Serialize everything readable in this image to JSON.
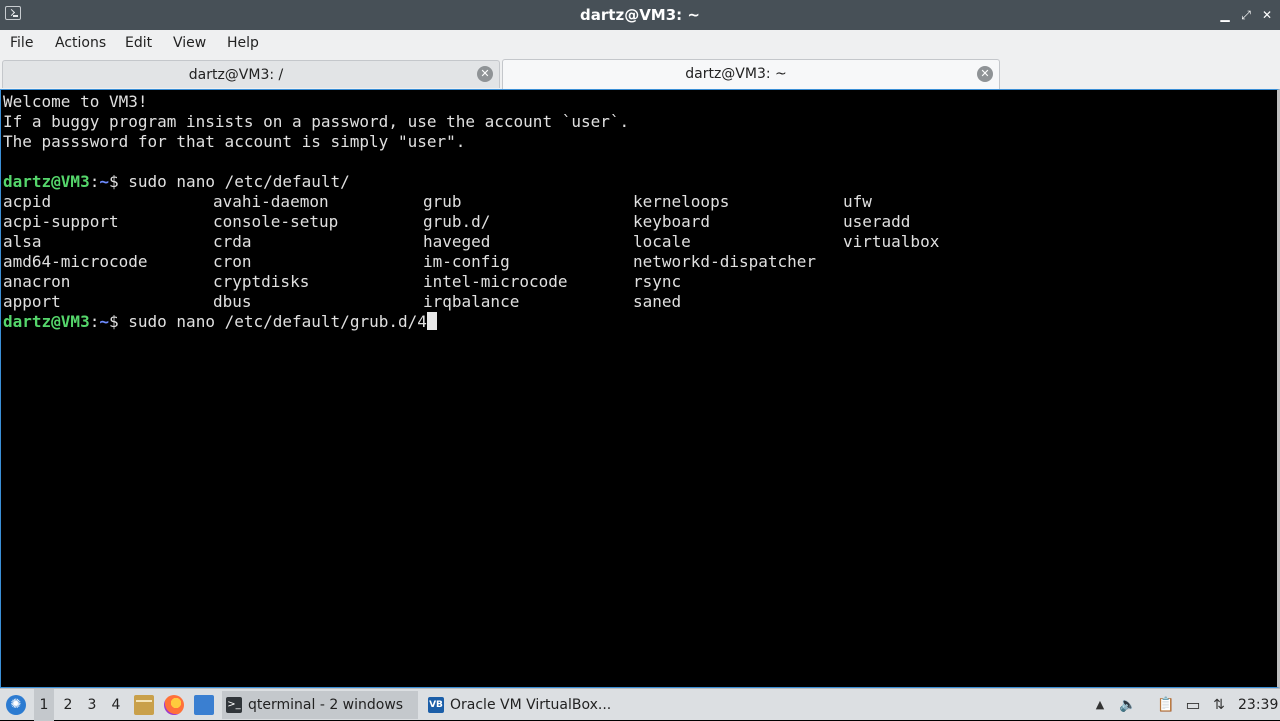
{
  "window": {
    "title": "dartz@VM3: ~",
    "controls": {
      "minimize": "▁",
      "maximize": "⤢",
      "close": "✕"
    }
  },
  "menu": [
    "File",
    "Actions",
    "Edit",
    "View",
    "Help"
  ],
  "tabs": [
    {
      "label": "dartz@VM3: /",
      "active": false
    },
    {
      "label": "dartz@VM3: ~",
      "active": true
    }
  ],
  "terminal": {
    "welcome": [
      "Welcome to VM3!",
      "If a buggy program insists on a password, use the account `user`.",
      "The passsword for that account is simply \"user\"."
    ],
    "prompt_user": "dartz@VM3",
    "prompt_sep": ":",
    "prompt_path": "~",
    "prompt_symbol": "$",
    "command1": " sudo nano /etc/default/",
    "listing": [
      [
        "acpid",
        "avahi-daemon",
        "grub",
        "kerneloops",
        "ufw"
      ],
      [
        "acpi-support",
        "console-setup",
        "grub.d/",
        "keyboard",
        "useradd"
      ],
      [
        "alsa",
        "crda",
        "haveged",
        "locale",
        "virtualbox"
      ],
      [
        "amd64-microcode",
        "cron",
        "im-config",
        "networkd-dispatcher",
        ""
      ],
      [
        "anacron",
        "cryptdisks",
        "intel-microcode",
        "rsync",
        ""
      ],
      [
        "apport",
        "dbus",
        "irqbalance",
        "saned",
        ""
      ]
    ],
    "command2": " sudo nano /etc/default/grub.d/4"
  },
  "taskbar": {
    "start_icon": "lubuntu-start-icon",
    "desktops": [
      "1",
      "2",
      "3",
      "4"
    ],
    "active_desktop": "1",
    "tasks": [
      {
        "label": "qterminal - 2 windows",
        "icon": "terminal-icon",
        "glyph": ">_"
      },
      {
        "label": "Oracle VM VirtualBox...",
        "icon": "virtualbox-icon",
        "glyph": "VB"
      }
    ],
    "tray": {
      "up_arrow": "▲",
      "volume": "🔈",
      "clipboard": "📋",
      "monitor": "▭",
      "network": "⇅"
    },
    "clock": "23:39"
  }
}
